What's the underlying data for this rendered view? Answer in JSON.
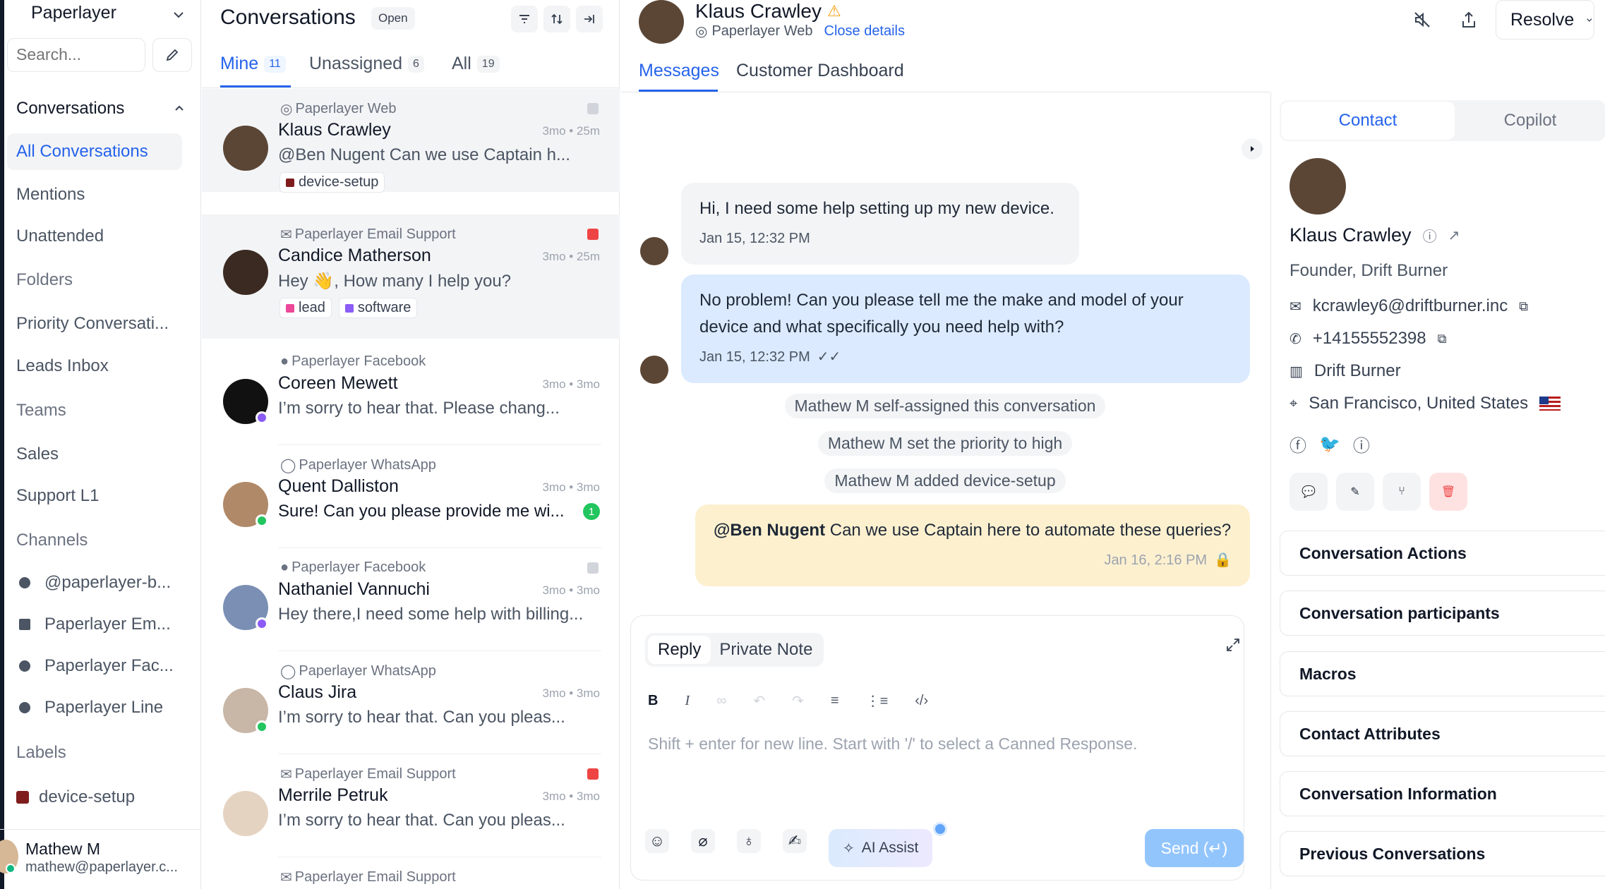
{
  "sidebar": {
    "brand": "Paperlayer",
    "search_placeholder": "Search...",
    "conversations_label": "Conversations",
    "nav": [
      "All Conversations",
      "Mentions",
      "Unattended"
    ],
    "folders_label": "Folders",
    "folders": [
      "Priority Conversati...",
      "Leads Inbox"
    ],
    "teams_label": "Teams",
    "teams": [
      "Sales",
      "Support L1"
    ],
    "channels_label": "Channels",
    "channels": [
      "@paperlayer-b...",
      "Paperlayer Em...",
      "Paperlayer Fac...",
      "Paperlayer Line"
    ],
    "labels_label": "Labels",
    "labels": [
      {
        "name": "device-setup",
        "color": "#7f1d1d"
      }
    ],
    "user": {
      "name": "Mathew M",
      "email": "mathew@paperlayer.c..."
    }
  },
  "list": {
    "title": "Conversations",
    "status_badge": "Open",
    "tabs": [
      {
        "label": "Mine",
        "count": "11"
      },
      {
        "label": "Unassigned",
        "count": "6"
      },
      {
        "label": "All",
        "count": "19"
      }
    ],
    "rows": [
      {
        "inbox": "Paperlayer Web",
        "name": "Klaus Crawley",
        "time": "3mo • 25m",
        "msg": "@Ben Nugent Can we use Captain h...",
        "tags": [
          {
            "label": "device-setup",
            "color": "#7f1d1d"
          }
        ],
        "priority": "#9ca3af"
      },
      {
        "inbox": "Paperlayer Email Support",
        "name": "Candice Matherson",
        "time": "3mo • 25m",
        "msg": "Hey 👋, How many I help you?",
        "tags": [
          {
            "label": "lead",
            "color": "#ec4899"
          },
          {
            "label": "software",
            "color": "#8b5cf6"
          }
        ],
        "priority": "#ef4444"
      },
      {
        "inbox": "Paperlayer Facebook",
        "name": "Coreen Mewett",
        "time": "3mo • 3mo",
        "msg": "I’m sorry to hear that. Please chang...",
        "tags": [],
        "priority": ""
      },
      {
        "inbox": "Paperlayer WhatsApp",
        "name": "Quent Dalliston",
        "time": "3mo • 3mo",
        "msg": "Sure! Can you please provide me wi...",
        "tags": [],
        "priority": "",
        "unread": "1"
      },
      {
        "inbox": "Paperlayer Facebook",
        "name": "Nathaniel Vannuchi",
        "time": "3mo • 3mo",
        "msg": "Hey there,I need some help with billing...",
        "tags": [],
        "priority": "#9ca3af"
      },
      {
        "inbox": "Paperlayer WhatsApp",
        "name": "Claus Jira",
        "time": "3mo • 3mo",
        "msg": "I’m sorry to hear that. Can you pleas...",
        "tags": [],
        "priority": ""
      },
      {
        "inbox": "Paperlayer Email Support",
        "name": "Merrile Petruk",
        "time": "3mo • 3mo",
        "msg": "I’m sorry to hear that. Can you pleas...",
        "tags": [],
        "priority": "#ef4444"
      },
      {
        "inbox": "Paperlayer Email Support",
        "name": "",
        "time": "",
        "msg": "",
        "tags": [],
        "priority": ""
      }
    ]
  },
  "chat": {
    "contact_name": "Klaus Crawley",
    "inbox": "Paperlayer Web",
    "close_details": "Close details",
    "resolve": "Resolve",
    "tabs": [
      "Messages",
      "Customer Dashboard"
    ],
    "messages": [
      {
        "text": "Hi, I need some help setting up my new device.",
        "time": "Jan 15, 12:32 PM"
      },
      {
        "text": "No problem! Can you please tell me the make and model of your device and what specifically you need help with?",
        "time": "Jan 15, 12:32 PM"
      }
    ],
    "activities": [
      "Mathew M self-assigned this conversation",
      "Mathew M set the priority to high",
      "Mathew M added device-setup"
    ],
    "note": {
      "mention": "@Ben Nugent",
      "text": " Can we use Captain here to automate these queries?",
      "time": "Jan 16, 2:16 PM"
    },
    "editor": {
      "tab_reply": "Reply",
      "tab_note": "Private Note",
      "placeholder": "Shift + enter for new line. Start with '/' to select a Canned Response.",
      "ai_assist": "AI Assist",
      "send": "Send (↵)"
    }
  },
  "panel": {
    "tabs": [
      "Contact",
      "Copilot"
    ],
    "name": "Klaus Crawley",
    "title": "Founder, Drift Burner",
    "email": "kcrawley6@driftburner.inc",
    "phone": "+14155552398",
    "company": "Drift Burner",
    "location": "San Francisco, United States",
    "sections": [
      "Conversation Actions",
      "Conversation participants",
      "Macros",
      "Contact Attributes",
      "Conversation Information",
      "Previous Conversations"
    ]
  }
}
